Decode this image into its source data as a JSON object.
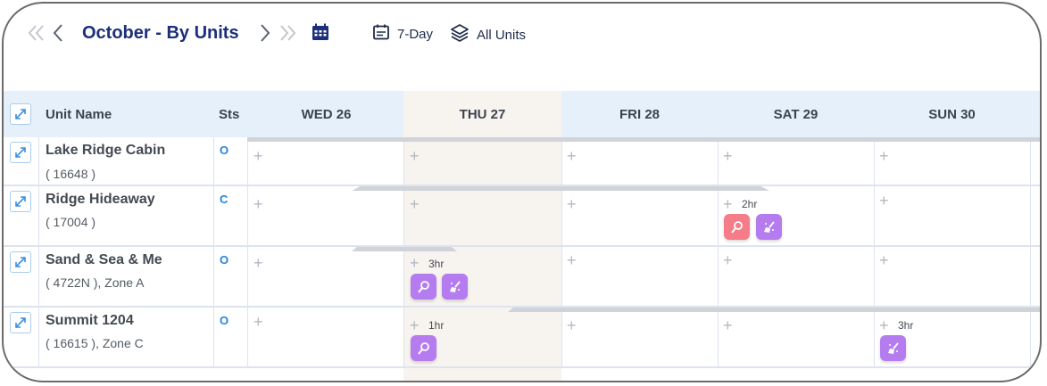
{
  "toolbar": {
    "title": "October - By Units",
    "view_7day": "7-Day",
    "view_units": "All Units"
  },
  "columns": {
    "unit_name": "Unit Name",
    "status": "Sts",
    "days": [
      "WED 26",
      "THU 27",
      "FRI 28",
      "SAT 29",
      "SUN 30"
    ]
  },
  "units": [
    {
      "name": "Lake Ridge Cabin",
      "sub": "( 16648 )",
      "status": "O"
    },
    {
      "name": "Ridge Hideaway",
      "sub": "( 17004 )",
      "status": "C"
    },
    {
      "name": "Sand & Sea & Me",
      "sub": "( 4722N ), Zone A",
      "status": "O"
    },
    {
      "name": "Summit 1204",
      "sub": "( 16615 ), Zone C",
      "status": "O"
    }
  ],
  "tasks": [
    {
      "unit": "Ridge Hideaway",
      "day": "SAT 29",
      "duration": "2hr",
      "icons": [
        "inspection-icon",
        "cleaning-icon"
      ],
      "colors": [
        "#f57d8a",
        "#b57cf0"
      ]
    },
    {
      "unit": "Sand & Sea & Me",
      "day": "THU 27",
      "duration": "3hr",
      "icons": [
        "inspection-icon",
        "cleaning-icon"
      ],
      "colors": [
        "#b57cf0",
        "#b57cf0"
      ]
    },
    {
      "unit": "Summit 1204",
      "day": "THU 27",
      "duration": "1hr",
      "icons": [
        "inspection-icon"
      ],
      "colors": [
        "#b57cf0"
      ]
    },
    {
      "unit": "Summit 1204",
      "day": "SUN 30",
      "duration": "3hr",
      "icons": [
        "cleaning-icon"
      ],
      "colors": [
        "#b57cf0"
      ]
    }
  ],
  "colors": {
    "title": "#1b2f7a",
    "header_bg": "#e6f0fb",
    "today_bg": "#f7f3ee",
    "status": "#2383e2",
    "chip_purple": "#b57cf0",
    "chip_red": "#f57d8a"
  }
}
